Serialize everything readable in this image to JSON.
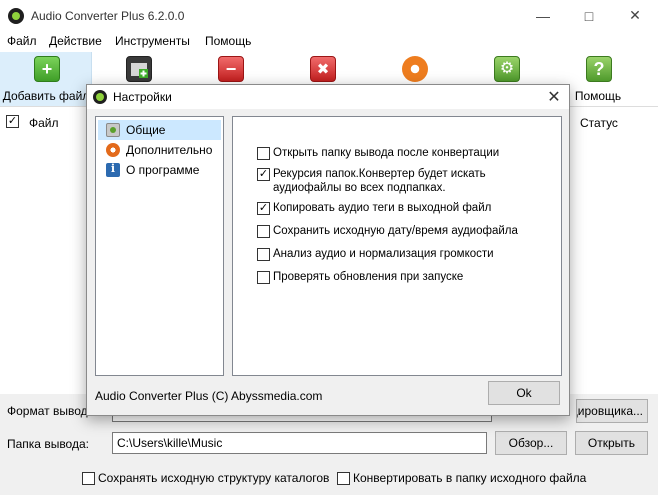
{
  "window": {
    "title": "Audio Converter Plus 6.2.0.0"
  },
  "menu": [
    "Файл",
    "Действие",
    "Инструменты",
    "Помощь"
  ],
  "toolbar": {
    "add_label": "Добавить файл",
    "help_label": "Помощь",
    "icons": [
      "add-file-icon",
      "add-folder-icon",
      "remove-icon",
      "clear-icon",
      "convert-icon",
      "settings-icon",
      "help-icon"
    ]
  },
  "filelist": {
    "col_file": "Файл",
    "col_status": "Статус",
    "file_checked": true
  },
  "bottom": {
    "format_label": "Формат вывода",
    "encoder_button": "дировщика...",
    "folder_label": "Папка вывода:",
    "folder_value": "C:\\Users\\kille\\Music",
    "browse_button": "Обзор...",
    "open_button": "Открыть",
    "keep_structure": "Сохранять исходную структуру каталогов",
    "convert_source": "Конвертировать в папку исходного файла"
  },
  "dialog": {
    "title": "Настройки",
    "nav": [
      {
        "label": "Общие",
        "icon": "general-icon",
        "selected": true
      },
      {
        "label": "Дополнительно",
        "icon": "additional-icon",
        "selected": false
      },
      {
        "label": "О программе",
        "icon": "about-icon",
        "selected": false
      }
    ],
    "options": [
      {
        "label": "Открыть папку вывода после конвертации",
        "checked": false
      },
      {
        "label": "Рекурсия папок.Конвертер будет искать аудиофайлы во всех подпапках.",
        "checked": true
      },
      {
        "label": "Копировать аудио теги в выходной файл",
        "checked": true
      },
      {
        "label": "Сохранить исходную дату/время аудиофайла",
        "checked": false
      },
      {
        "label": "Анализ аудио и нормализация громкости",
        "checked": false
      },
      {
        "label": "Проверять обновления при запуске",
        "checked": false
      }
    ],
    "footer": "Audio Converter Plus (C) Abyssmedia.com",
    "ok_label": "Ok"
  }
}
